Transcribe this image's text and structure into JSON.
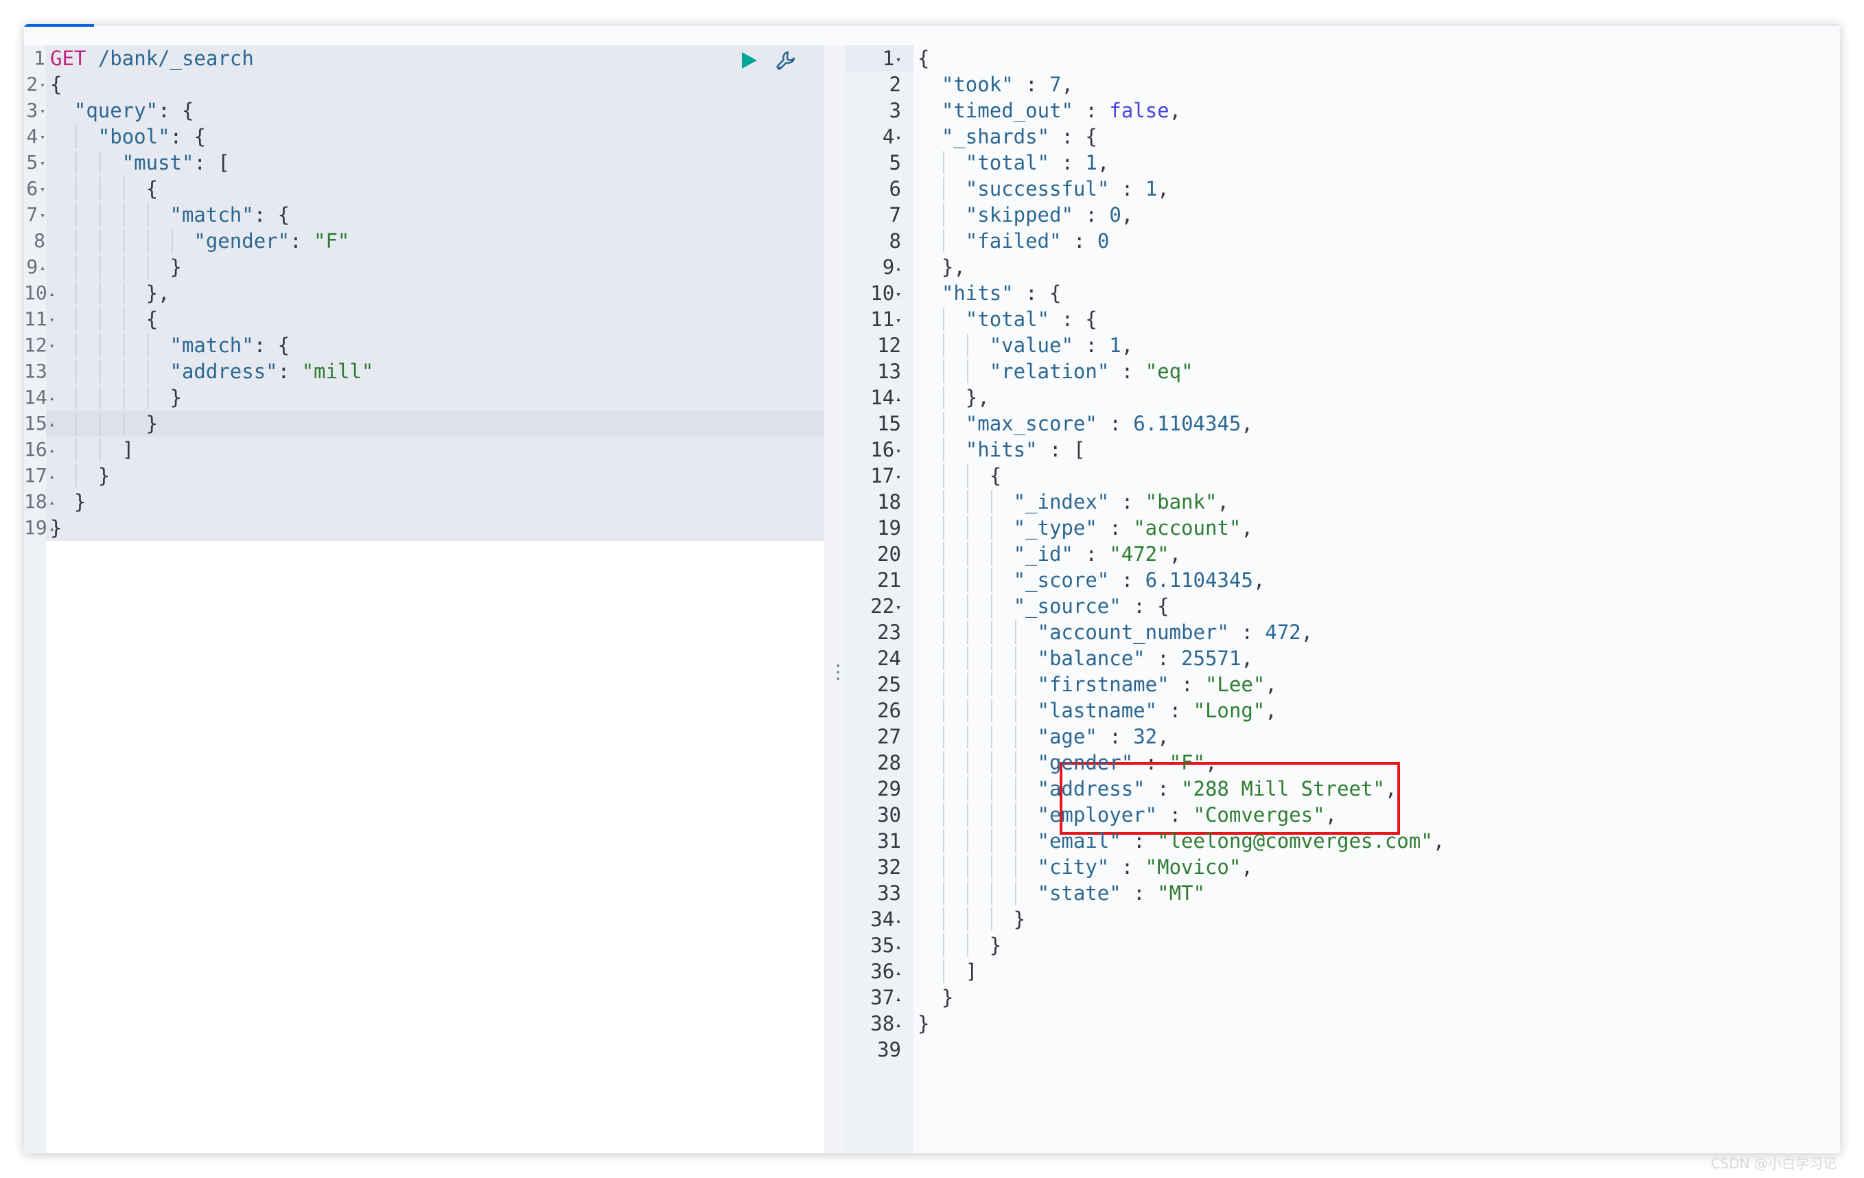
{
  "request": {
    "method": "GET",
    "path": " /bank/_search",
    "run_label": "Click to send request",
    "settings_label": "Request options",
    "lines": [
      {
        "num": "1",
        "fold": "",
        "indent": 0,
        "parts": []
      },
      {
        "num": "2",
        "fold": "▾",
        "indent": 0,
        "parts": [
          [
            "p",
            "{"
          ]
        ]
      },
      {
        "num": "3",
        "fold": "▾",
        "indent": 1,
        "parts": [
          [
            "k",
            "\"query\""
          ],
          [
            "p",
            ": {"
          ]
        ]
      },
      {
        "num": "4",
        "fold": "▾",
        "indent": 2,
        "parts": [
          [
            "k",
            "\"bool\""
          ],
          [
            "p",
            ": {"
          ]
        ]
      },
      {
        "num": "5",
        "fold": "▾",
        "indent": 3,
        "parts": [
          [
            "k",
            "\"must\""
          ],
          [
            "p",
            ": ["
          ]
        ]
      },
      {
        "num": "6",
        "fold": "▾",
        "indent": 4,
        "parts": [
          [
            "p",
            "{"
          ]
        ]
      },
      {
        "num": "7",
        "fold": "▾",
        "indent": 5,
        "parts": [
          [
            "k",
            "\"match\""
          ],
          [
            "p",
            ": {"
          ]
        ]
      },
      {
        "num": "8",
        "fold": "",
        "indent": 6,
        "parts": [
          [
            "k",
            "\"gender\""
          ],
          [
            "p",
            ": "
          ],
          [
            "s",
            "\"F\""
          ]
        ]
      },
      {
        "num": "9",
        "fold": "▴",
        "indent": 5,
        "parts": [
          [
            "p",
            "}"
          ]
        ]
      },
      {
        "num": "10",
        "fold": "▴",
        "indent": 4,
        "parts": [
          [
            "p",
            "},"
          ]
        ]
      },
      {
        "num": "11",
        "fold": "▾",
        "indent": 4,
        "parts": [
          [
            "p",
            "{"
          ]
        ]
      },
      {
        "num": "12",
        "fold": "▾",
        "indent": 5,
        "parts": [
          [
            "k",
            "\"match\""
          ],
          [
            "p",
            ": {"
          ]
        ]
      },
      {
        "num": "13",
        "fold": "",
        "indent": 5,
        "parts": [
          [
            "k",
            "\"address\""
          ],
          [
            "p",
            ": "
          ],
          [
            "s",
            "\"mill\""
          ]
        ]
      },
      {
        "num": "14",
        "fold": "▴",
        "indent": 5,
        "parts": [
          [
            "p",
            "}"
          ]
        ]
      },
      {
        "num": "15",
        "fold": "▴",
        "indent": 4,
        "parts": [
          [
            "p",
            "}"
          ]
        ]
      },
      {
        "num": "16",
        "fold": "▴",
        "indent": 3,
        "parts": [
          [
            "p",
            "]"
          ]
        ]
      },
      {
        "num": "17",
        "fold": "▴",
        "indent": 2,
        "parts": [
          [
            "p",
            "}"
          ]
        ]
      },
      {
        "num": "18",
        "fold": "▴",
        "indent": 1,
        "parts": [
          [
            "p",
            "}"
          ]
        ]
      },
      {
        "num": "19",
        "fold": "▴",
        "indent": 0,
        "parts": [
          [
            "p",
            "}"
          ]
        ]
      }
    ]
  },
  "response": {
    "lines": [
      {
        "num": "1",
        "fold": "▾",
        "indent": 0,
        "parts": [
          [
            "p",
            "{"
          ]
        ]
      },
      {
        "num": "2",
        "fold": "",
        "indent": 1,
        "parts": [
          [
            "k",
            "\"took\""
          ],
          [
            "p",
            " : "
          ],
          [
            "n",
            "7"
          ],
          [
            "p",
            ","
          ]
        ]
      },
      {
        "num": "3",
        "fold": "",
        "indent": 1,
        "parts": [
          [
            "k",
            "\"timed_out\""
          ],
          [
            "p",
            " : "
          ],
          [
            "b",
            "false"
          ],
          [
            "p",
            ","
          ]
        ]
      },
      {
        "num": "4",
        "fold": "▾",
        "indent": 1,
        "parts": [
          [
            "k",
            "\"_shards\""
          ],
          [
            "p",
            " : {"
          ]
        ]
      },
      {
        "num": "5",
        "fold": "",
        "indent": 2,
        "parts": [
          [
            "k",
            "\"total\""
          ],
          [
            "p",
            " : "
          ],
          [
            "n",
            "1"
          ],
          [
            "p",
            ","
          ]
        ]
      },
      {
        "num": "6",
        "fold": "",
        "indent": 2,
        "parts": [
          [
            "k",
            "\"successful\""
          ],
          [
            "p",
            " : "
          ],
          [
            "n",
            "1"
          ],
          [
            "p",
            ","
          ]
        ]
      },
      {
        "num": "7",
        "fold": "",
        "indent": 2,
        "parts": [
          [
            "k",
            "\"skipped\""
          ],
          [
            "p",
            " : "
          ],
          [
            "n",
            "0"
          ],
          [
            "p",
            ","
          ]
        ]
      },
      {
        "num": "8",
        "fold": "",
        "indent": 2,
        "parts": [
          [
            "k",
            "\"failed\""
          ],
          [
            "p",
            " : "
          ],
          [
            "n",
            "0"
          ]
        ]
      },
      {
        "num": "9",
        "fold": "▴",
        "indent": 1,
        "parts": [
          [
            "p",
            "},"
          ]
        ]
      },
      {
        "num": "10",
        "fold": "▾",
        "indent": 1,
        "parts": [
          [
            "k",
            "\"hits\""
          ],
          [
            "p",
            " : {"
          ]
        ]
      },
      {
        "num": "11",
        "fold": "▾",
        "indent": 2,
        "parts": [
          [
            "k",
            "\"total\""
          ],
          [
            "p",
            " : {"
          ]
        ]
      },
      {
        "num": "12",
        "fold": "",
        "indent": 3,
        "parts": [
          [
            "k",
            "\"value\""
          ],
          [
            "p",
            " : "
          ],
          [
            "n",
            "1"
          ],
          [
            "p",
            ","
          ]
        ]
      },
      {
        "num": "13",
        "fold": "",
        "indent": 3,
        "parts": [
          [
            "k",
            "\"relation\""
          ],
          [
            "p",
            " : "
          ],
          [
            "s",
            "\"eq\""
          ]
        ]
      },
      {
        "num": "14",
        "fold": "▴",
        "indent": 2,
        "parts": [
          [
            "p",
            "},"
          ]
        ]
      },
      {
        "num": "15",
        "fold": "",
        "indent": 2,
        "parts": [
          [
            "k",
            "\"max_score\""
          ],
          [
            "p",
            " : "
          ],
          [
            "n",
            "6.1104345"
          ],
          [
            "p",
            ","
          ]
        ]
      },
      {
        "num": "16",
        "fold": "▾",
        "indent": 2,
        "parts": [
          [
            "k",
            "\"hits\""
          ],
          [
            "p",
            " : ["
          ]
        ]
      },
      {
        "num": "17",
        "fold": "▾",
        "indent": 3,
        "parts": [
          [
            "p",
            "{"
          ]
        ]
      },
      {
        "num": "18",
        "fold": "",
        "indent": 4,
        "parts": [
          [
            "k",
            "\"_index\""
          ],
          [
            "p",
            " : "
          ],
          [
            "s",
            "\"bank\""
          ],
          [
            "p",
            ","
          ]
        ]
      },
      {
        "num": "19",
        "fold": "",
        "indent": 4,
        "parts": [
          [
            "k",
            "\"_type\""
          ],
          [
            "p",
            " : "
          ],
          [
            "s",
            "\"account\""
          ],
          [
            "p",
            ","
          ]
        ]
      },
      {
        "num": "20",
        "fold": "",
        "indent": 4,
        "parts": [
          [
            "k",
            "\"_id\""
          ],
          [
            "p",
            " : "
          ],
          [
            "s",
            "\"472\""
          ],
          [
            "p",
            ","
          ]
        ]
      },
      {
        "num": "21",
        "fold": "",
        "indent": 4,
        "parts": [
          [
            "k",
            "\"_score\""
          ],
          [
            "p",
            " : "
          ],
          [
            "n",
            "6.1104345"
          ],
          [
            "p",
            ","
          ]
        ]
      },
      {
        "num": "22",
        "fold": "▾",
        "indent": 4,
        "parts": [
          [
            "k",
            "\"_source\""
          ],
          [
            "p",
            " : {"
          ]
        ]
      },
      {
        "num": "23",
        "fold": "",
        "indent": 5,
        "parts": [
          [
            "k",
            "\"account_number\""
          ],
          [
            "p",
            " : "
          ],
          [
            "n",
            "472"
          ],
          [
            "p",
            ","
          ]
        ]
      },
      {
        "num": "24",
        "fold": "",
        "indent": 5,
        "parts": [
          [
            "k",
            "\"balance\""
          ],
          [
            "p",
            " : "
          ],
          [
            "n",
            "25571"
          ],
          [
            "p",
            ","
          ]
        ]
      },
      {
        "num": "25",
        "fold": "",
        "indent": 5,
        "parts": [
          [
            "k",
            "\"firstname\""
          ],
          [
            "p",
            " : "
          ],
          [
            "s",
            "\"Lee\""
          ],
          [
            "p",
            ","
          ]
        ]
      },
      {
        "num": "26",
        "fold": "",
        "indent": 5,
        "parts": [
          [
            "k",
            "\"lastname\""
          ],
          [
            "p",
            " : "
          ],
          [
            "s",
            "\"Long\""
          ],
          [
            "p",
            ","
          ]
        ]
      },
      {
        "num": "27",
        "fold": "",
        "indent": 5,
        "parts": [
          [
            "k",
            "\"age\""
          ],
          [
            "p",
            " : "
          ],
          [
            "n",
            "32"
          ],
          [
            "p",
            ","
          ]
        ]
      },
      {
        "num": "28",
        "fold": "",
        "indent": 5,
        "parts": [
          [
            "k",
            "\"gender\""
          ],
          [
            "p",
            " : "
          ],
          [
            "s",
            "\"F\""
          ],
          [
            "p",
            ","
          ]
        ]
      },
      {
        "num": "29",
        "fold": "",
        "indent": 5,
        "parts": [
          [
            "k",
            "\"address\""
          ],
          [
            "p",
            " : "
          ],
          [
            "s",
            "\"288 Mill Street\""
          ],
          [
            "p",
            ","
          ]
        ]
      },
      {
        "num": "30",
        "fold": "",
        "indent": 5,
        "parts": [
          [
            "k",
            "\"employer\""
          ],
          [
            "p",
            " : "
          ],
          [
            "s",
            "\"Comverges\""
          ],
          [
            "p",
            ","
          ]
        ]
      },
      {
        "num": "31",
        "fold": "",
        "indent": 5,
        "parts": [
          [
            "k",
            "\"email\""
          ],
          [
            "p",
            " : "
          ],
          [
            "s",
            "\"leelong@comverges.com\""
          ],
          [
            "p",
            ","
          ]
        ]
      },
      {
        "num": "32",
        "fold": "",
        "indent": 5,
        "parts": [
          [
            "k",
            "\"city\""
          ],
          [
            "p",
            " : "
          ],
          [
            "s",
            "\"Movico\""
          ],
          [
            "p",
            ","
          ]
        ]
      },
      {
        "num": "33",
        "fold": "",
        "indent": 5,
        "parts": [
          [
            "k",
            "\"state\""
          ],
          [
            "p",
            " : "
          ],
          [
            "s",
            "\"MT\""
          ]
        ]
      },
      {
        "num": "34",
        "fold": "▴",
        "indent": 4,
        "parts": [
          [
            "p",
            "}"
          ]
        ]
      },
      {
        "num": "35",
        "fold": "▴",
        "indent": 3,
        "parts": [
          [
            "p",
            "}"
          ]
        ]
      },
      {
        "num": "36",
        "fold": "▴",
        "indent": 2,
        "parts": [
          [
            "p",
            "]"
          ]
        ]
      },
      {
        "num": "37",
        "fold": "▴",
        "indent": 1,
        "parts": [
          [
            "p",
            "}"
          ]
        ]
      },
      {
        "num": "38",
        "fold": "▴",
        "indent": 0,
        "parts": [
          [
            "p",
            "}"
          ]
        ]
      },
      {
        "num": "39",
        "fold": "",
        "indent": 0,
        "parts": []
      }
    ]
  },
  "divider": {
    "handle": "⋮"
  },
  "watermark": "CSDN @小白学习记",
  "colors": {
    "key": "#2b6792",
    "string": "#2e7d32",
    "number": "#2b6792",
    "boolean": "#4846d6",
    "method": "#c1247f",
    "highlight": "#e8151b"
  },
  "icons": {
    "run": "play-icon",
    "settings": "wrench-icon"
  }
}
